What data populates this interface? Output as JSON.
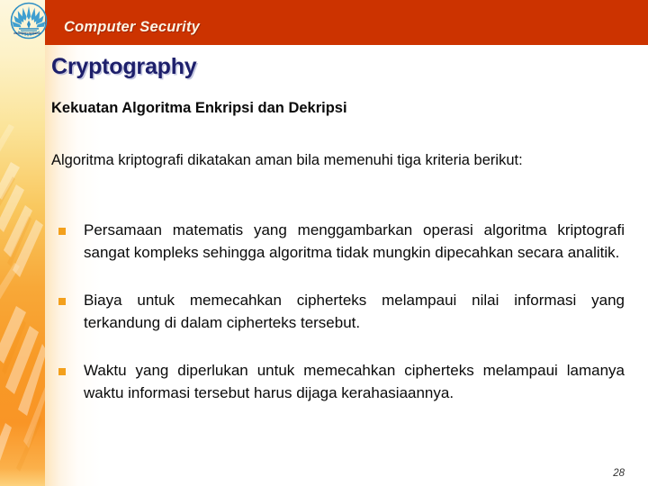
{
  "header": {
    "title": "Computer Security",
    "bar_color": "#cc3300",
    "title_color": "#fdf4e3"
  },
  "logo": {
    "name": "universitas-indonesia-makara-logo",
    "subtitle": "UNIVERSITAS INDONESIA",
    "color": "#2f8fc4"
  },
  "slide": {
    "title": "Cryptography",
    "title_color": "#1d1f6b",
    "subhead": "Kekuatan Algoritma Enkripsi dan Dekripsi",
    "intro": "Algoritma kriptografi dikatakan aman bila memenuhi tiga kriteria berikut:",
    "bullets": [
      "Persamaan matematis yang menggambarkan operasi algoritma kriptografi sangat kompleks sehingga algoritma tidak mungkin dipecahkan secara analitik.",
      "Biaya untuk memecahkan cipherteks melampaui nilai informasi yang terkandung di dalam cipherteks tersebut.",
      "Waktu yang diperlukan untuk memecahkan cipherteks melampaui lamanya waktu informasi tersebut harus dijaga kerahasiaannya."
    ],
    "bullet_marker_color": "#f3a01c",
    "page_number": "28"
  }
}
